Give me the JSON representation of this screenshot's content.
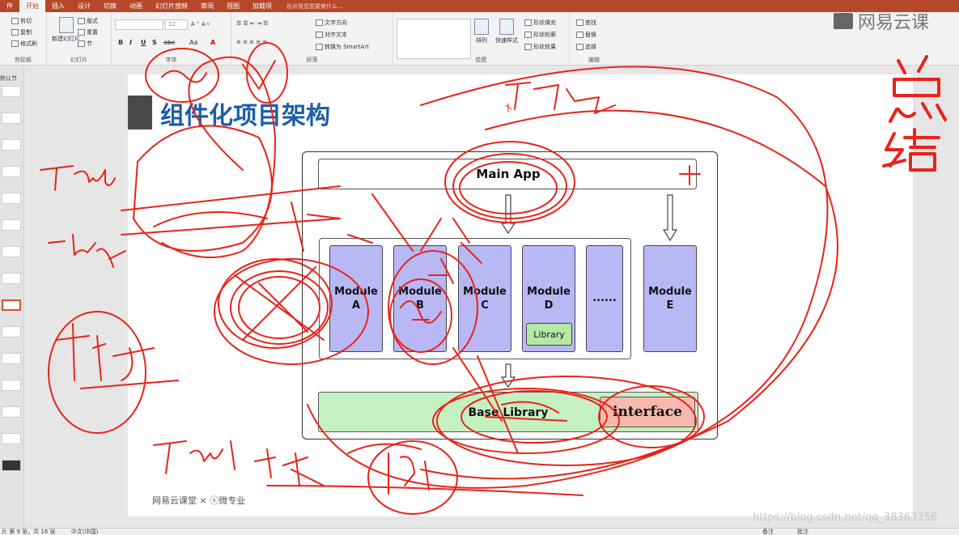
{
  "ribbon": {
    "tabs": [
      "件",
      "开始",
      "插入",
      "设计",
      "切换",
      "动画",
      "幻灯片放映",
      "审阅",
      "视图",
      "加载项"
    ],
    "active_tab": "开始",
    "tell_me": "告诉我您想要做什么...",
    "clipboard": {
      "cut": "剪切",
      "copy": "复制",
      "format_painter": "格式刷",
      "label": "剪贴板"
    },
    "slides": {
      "new_slide": "新建幻灯片",
      "layout": "版式",
      "reset": "重置",
      "section": "节",
      "label": "幻灯片"
    },
    "font": {
      "size": "12",
      "label": "字体",
      "bold": "B",
      "italic": "I",
      "underline": "U",
      "strike": "S",
      "spacing": "abc",
      "case": "Aa"
    },
    "paragraph": {
      "text_direction": "文字方向",
      "align_text": "对齐文本",
      "smartart": "转换为 SmartArt",
      "label": "段落"
    },
    "drawing": {
      "arrange": "排列",
      "quick_styles": "快速样式",
      "shape_fill": "形状填充",
      "shape_outline": "形状轮廓",
      "shape_effects": "形状效果",
      "label": "绘图"
    },
    "editing": {
      "find": "查找",
      "replace": "替换",
      "select": "选择",
      "label": "编辑"
    }
  },
  "thumbnails": {
    "section_title": "默认节",
    "selected_index": 9
  },
  "slide": {
    "title": "组件化项目架构",
    "main_app": "Main App",
    "modules": [
      {
        "line1": "Module",
        "line2": "A"
      },
      {
        "line1": "Module",
        "line2": "B"
      },
      {
        "line1": "Module",
        "line2": "C"
      },
      {
        "line1": "Module",
        "line2": "D"
      },
      {
        "line1": "......",
        "line2": ""
      },
      {
        "line1": "Module",
        "line2": "E"
      }
    ],
    "library": "Library",
    "base_library": "Base Library",
    "interface": "interface",
    "footer": "网易云课堂 × ⓢ微专业"
  },
  "watermarks": {
    "logo": "网易云课",
    "csdn": "https://blog.csdn.net/qq_38363256"
  },
  "annotations": {
    "summary_line1": "总",
    "summary_line2": "结"
  },
  "statusbar": {
    "slide_info": "片 第 9 张，共 18 张",
    "language": "中文(中国)",
    "notes": "备注",
    "comments": "批注"
  },
  "colors": {
    "ribbon_accent": "#b7472a",
    "module_fill": "#b7b8f4",
    "library_fill": "#b5e8a5",
    "interface_fill": "#f6b9ad",
    "ink": "#e8231a",
    "title": "#1c5ea8"
  }
}
